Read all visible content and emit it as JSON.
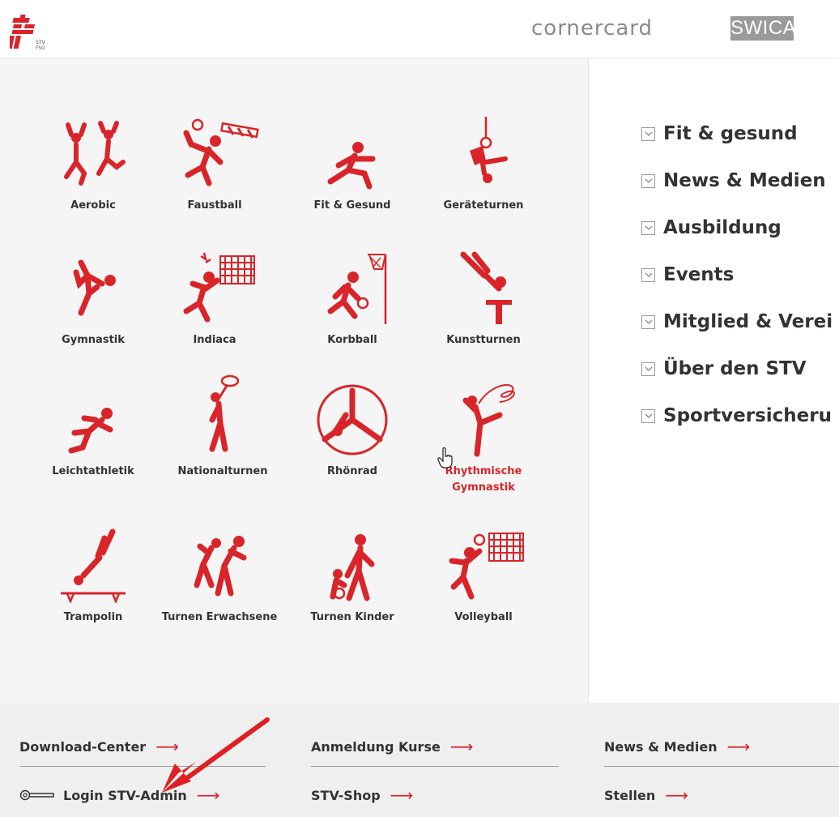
{
  "header": {
    "sponsor_1": "cornercard",
    "sponsor_2": "SWICA"
  },
  "sports": [
    {
      "label": "Aerobic",
      "icon": "aerobic-icon"
    },
    {
      "label": "Faustball",
      "icon": "faustball-icon"
    },
    {
      "label": "Fit & Gesund",
      "icon": "fit-gesund-icon"
    },
    {
      "label": "Geräteturnen",
      "icon": "geraeteturnen-icon"
    },
    {
      "label": "Gymnastik",
      "icon": "gymnastik-icon"
    },
    {
      "label": "Indiaca",
      "icon": "indiaca-icon"
    },
    {
      "label": "Korbball",
      "icon": "korbball-icon"
    },
    {
      "label": "Kunstturnen",
      "icon": "kunstturnen-icon"
    },
    {
      "label": "Leichtathletik",
      "icon": "leichtathletik-icon"
    },
    {
      "label": "Nationalturnen",
      "icon": "nationalturnen-icon"
    },
    {
      "label": "Rhönrad",
      "icon": "rhoenrad-icon"
    },
    {
      "label": "Rhythmische Gymnastik",
      "icon": "rhythmische-gymnastik-icon"
    },
    {
      "label": "Trampolin",
      "icon": "trampolin-icon"
    },
    {
      "label": "Turnen Erwachsene",
      "icon": "turnen-erwachsene-icon"
    },
    {
      "label": "Turnen Kinder",
      "icon": "turnen-kinder-icon"
    },
    {
      "label": "Volleyball",
      "icon": "volleyball-icon"
    }
  ],
  "menu": [
    {
      "label": "Fit & gesund"
    },
    {
      "label": "News & Medien"
    },
    {
      "label": "Ausbildung"
    },
    {
      "label": "Events"
    },
    {
      "label": "Mitglied & Verei"
    },
    {
      "label": "Über den STV"
    },
    {
      "label": "Sportversicheru"
    }
  ],
  "footer": {
    "download_center": "Download-Center",
    "login": "Login STV-Admin",
    "anmeldung": "Anmeldung Kurse",
    "shop": "STV-Shop",
    "news": "News & Medien",
    "stellen": "Stellen",
    "arrow": "⟶"
  },
  "colors": {
    "brand_red": "#d9252a",
    "text": "#333333",
    "panel": "#f5f5f5",
    "footer": "#efefef"
  }
}
